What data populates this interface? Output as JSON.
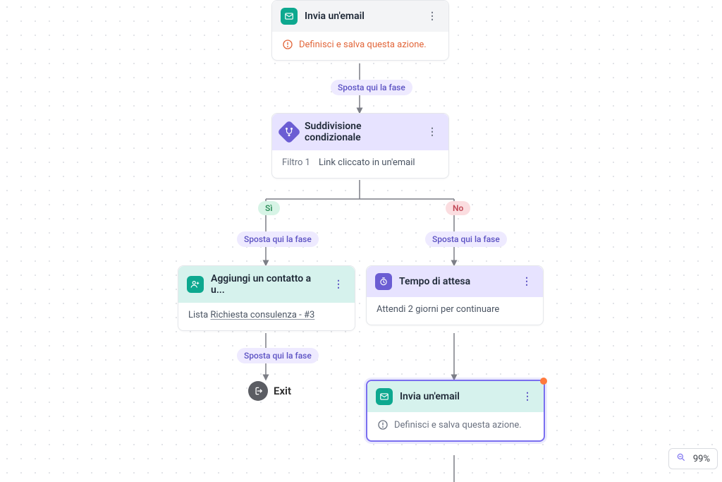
{
  "labels": {
    "move_phase": "Sposta qui la fase",
    "branch_yes": "Sì",
    "branch_no": "No",
    "exit": "Exit",
    "zoom": "99%"
  },
  "nodes": {
    "email_top": {
      "title": "Invia un'email",
      "warning": "Definisci e salva questa azione."
    },
    "conditional": {
      "title": "Suddivisione condizionale",
      "filter_label": "Filtro 1",
      "filter_desc": "Link cliccato in un'email"
    },
    "add_contact": {
      "title": "Aggiungi un contatto a u...",
      "body_prefix": "Lista ",
      "body_link": "Richiesta consulenza - #3"
    },
    "wait": {
      "title": "Tempo di attesa",
      "body": "Attendi 2 giorni per continuare"
    },
    "email_bottom": {
      "title": "Invia un'email",
      "info": "Definisci e salva questa azione."
    }
  }
}
